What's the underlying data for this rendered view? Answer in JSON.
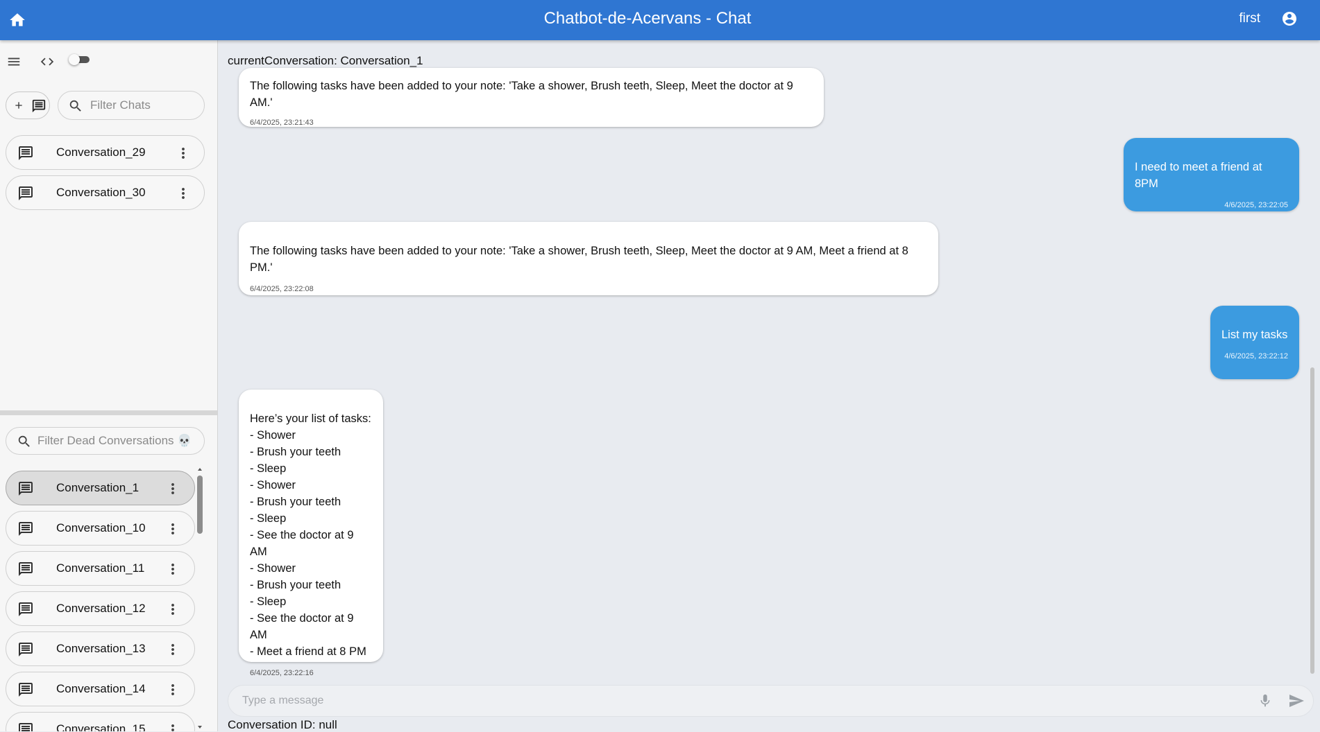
{
  "header": {
    "title": "Chatbot-de-Acervans - Chat",
    "user": "first",
    "color": "#2f76d2"
  },
  "sidebar": {
    "filter_chats_placeholder": "Filter Chats",
    "chats": [
      {
        "label": "Conversation_29"
      },
      {
        "label": "Conversation_30"
      }
    ],
    "filter_dead_placeholder": "Filter Dead Conversations 💀",
    "dead_conversations": [
      {
        "label": "Conversation_1",
        "active": true
      },
      {
        "label": "Conversation_10"
      },
      {
        "label": "Conversation_11"
      },
      {
        "label": "Conversation_12"
      },
      {
        "label": "Conversation_13"
      },
      {
        "label": "Conversation_14"
      },
      {
        "label": "Conversation_15"
      }
    ]
  },
  "main": {
    "current_conversation": "currentConversation: Conversation_1",
    "messages": [
      {
        "role": "bot",
        "text": "The following tasks have been added to your note: 'Take a shower, Brush teeth, Sleep, Meet the doctor at 9 AM.'",
        "time": "6/4/2025, 23:21:43"
      },
      {
        "role": "user",
        "text": "I need to meet a friend at 8PM",
        "time": "4/6/2025, 23:22:05"
      },
      {
        "role": "bot",
        "text": "The following tasks have been added to your note: 'Take a shower, Brush teeth, Sleep, Meet the doctor at 9 AM, Meet a friend at 8 PM.'",
        "time": "6/4/2025, 23:22:08"
      },
      {
        "role": "user",
        "text": "List my tasks",
        "time": "4/6/2025, 23:22:12"
      },
      {
        "role": "bot",
        "text": "Here’s your list of tasks:\n- Shower\n- Brush your teeth\n- Sleep\n- Shower\n- Brush your teeth\n- Sleep\n- See the doctor at 9 AM\n- Shower\n- Brush your teeth\n- Sleep\n- See the doctor at 9 AM\n- Meet a friend at 8 PM",
        "time": "6/4/2025, 23:22:16"
      }
    ],
    "composer_placeholder": "Type a message",
    "conversation_id": "Conversation ID: null",
    "user_bubble_color": "#3c9be0"
  }
}
